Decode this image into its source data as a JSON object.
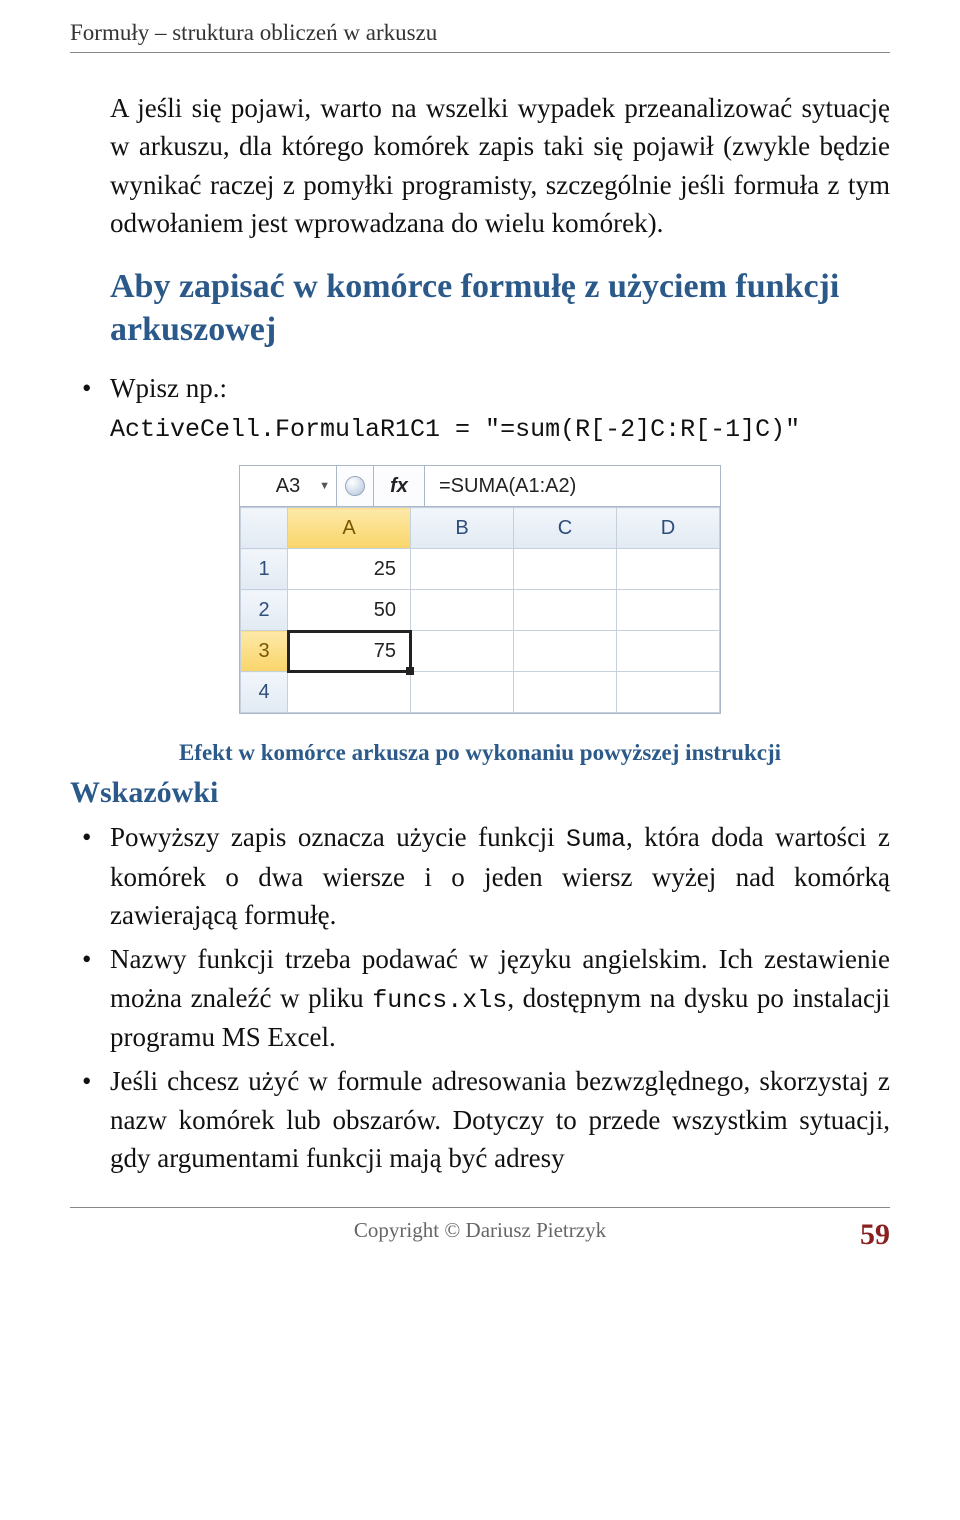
{
  "header": {
    "running": "Formuły – struktura obliczeń w arkuszu"
  },
  "paragraphs": {
    "intro": "A jeśli się pojawi, warto na wszelki wypadek przeanalizować sytuację w arkuszu, dla którego komórek zapis taki się pojawił (zwykle będzie wynikać raczej z pomyłki programisty, szczególnie jeśli formuła z tym odwołaniem jest wprowadzana do wielu komórek)."
  },
  "instruction": {
    "heading": "Aby zapisać w komórce formułę z użyciem funkcji arkuszowej",
    "bullet1_lead": "Wpisz np.:",
    "bullet1_code": "ActiveCell.FormulaR1C1 = \"=sum(R[-2]C:R[-1]C)\""
  },
  "excel": {
    "name_box": "A3",
    "fx_label": "fx",
    "formula_bar": "=SUMA(A1:A2)",
    "cols": [
      "A",
      "B",
      "C",
      "D"
    ],
    "rows": [
      "1",
      "2",
      "3",
      "4"
    ],
    "cells": {
      "A1": "25",
      "A2": "50",
      "A3": "75"
    }
  },
  "caption": "Efekt w komórce arkusza po wykonaniu powyższej instrukcji",
  "hints": {
    "heading": "Wskazówki",
    "b1_a": "Powyższy zapis oznacza użycie funkcji ",
    "b1_code": "Suma",
    "b1_b": ", która doda wartości z komórek o dwa wiersze i o jeden wiersz wyżej nad komórką zawierającą formułę.",
    "b2_a": "Nazwy funkcji trzeba podawać w języku angielskim. Ich zestawienie można znaleźć w pliku ",
    "b2_code": "funcs.xls",
    "b2_b": ", dostępnym na dysku po instalacji programu MS Excel.",
    "b3": "Jeśli chcesz użyć w formule adresowania bezwzględnego, skorzystaj z nazw komórek lub obszarów. Dotyczy to przede wszystkim sytuacji, gdy argumentami funkcji mają być adresy"
  },
  "footer": {
    "copyright": "Copyright © Dariusz Pietrzyk",
    "page": "59"
  },
  "chart_data": {
    "type": "table",
    "title": "Excel worksheet fragment",
    "columns": [
      "A",
      "B",
      "C",
      "D"
    ],
    "rows": [
      {
        "row": 1,
        "A": 25,
        "B": null,
        "C": null,
        "D": null
      },
      {
        "row": 2,
        "A": 50,
        "B": null,
        "C": null,
        "D": null
      },
      {
        "row": 3,
        "A": 75,
        "B": null,
        "C": null,
        "D": null
      },
      {
        "row": 4,
        "A": null,
        "B": null,
        "C": null,
        "D": null
      }
    ],
    "active_cell": "A3",
    "formula_bar": "=SUMA(A1:A2)"
  }
}
